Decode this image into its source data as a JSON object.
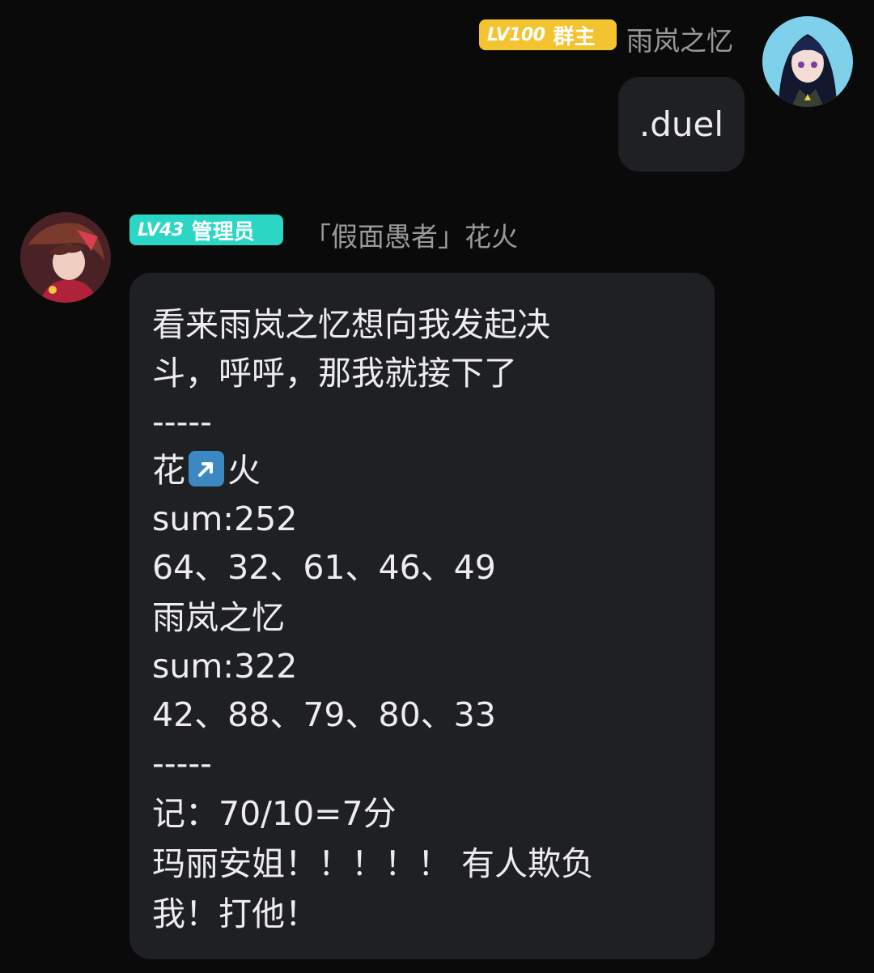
{
  "messages": [
    {
      "side": "right",
      "level": "LV100",
      "role": "群主",
      "nickname": "雨岚之忆",
      "text": ".duel"
    },
    {
      "side": "left",
      "level": "LV43",
      "role": "管理员",
      "nickname": "「假面愚者」花火",
      "lines": [
        "看来雨岚之忆想向我发起决",
        "斗，呼呼，那我就接下了",
        "-----",
        "火",
        "sum:252",
        "64、32、61、46、49",
        "雨岚之忆",
        "sum:322",
        "42、88、79、80、33",
        "-----",
        "记：70/10=7分",
        "玛丽安姐！！！！！ 有人欺负",
        "我！打他！"
      ],
      "name_prefix": "花",
      "name_emoji": "up-right-arrow-emoji"
    }
  ],
  "colors": {
    "background": "#0a0a0a",
    "bubble": "#1f2024",
    "owner_badge": "#f4c430",
    "admin_badge": "#2bd6c4",
    "nickname": "#9a9a9c"
  }
}
